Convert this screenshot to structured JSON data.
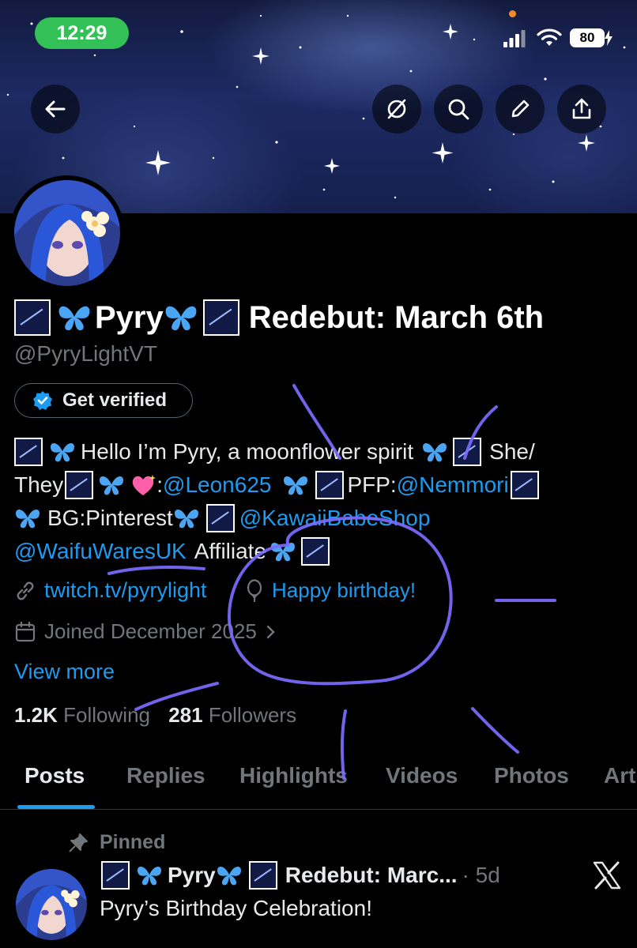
{
  "status_bar": {
    "time": "12:29",
    "battery": "80"
  },
  "profile": {
    "display_name_text": "Pyry",
    "display_name_suffix": "Redebut: March 6th",
    "handle": "@PyryLightVT",
    "verify_label": "Get verified",
    "bio": {
      "line1_text": "Hello I’m Pyry, a moonflower spirit",
      "line1_end": "She/",
      "line2_start": "They",
      "line2_sep": ":",
      "line2_mention1": "@Leon625",
      "line2_pfp": "PFP:",
      "line2_mention2": "@Nemmori",
      "line3_bg": "BG:Pinterest",
      "line3_mention": "@KawaiiBabeShop",
      "line4_mention": "@WaifuWaresUK",
      "line4_text": "Affiliate"
    },
    "website": "twitch.tv/pyrylight",
    "birthday": "Happy birthday!",
    "joined": "Joined December 2025",
    "view_more": "View more",
    "following_count": "1.2K",
    "following_label": "Following",
    "followers_count": "281",
    "followers_label": "Followers"
  },
  "tabs": [
    "Posts",
    "Replies",
    "Highlights",
    "Videos",
    "Photos",
    "Art"
  ],
  "pinned_post": {
    "pinned_label": "Pinned",
    "author_name": "Pyry",
    "author_suffix": "Redebut: Marc...",
    "age": "· 5d",
    "text": "Pyry’s Birthday Celebration!"
  },
  "icons": {
    "back": "back-arrow-icon",
    "grok": "grok-icon",
    "search": "search-icon",
    "edit": "pencil-icon",
    "share": "share-icon"
  },
  "colors": {
    "accent": "#1d9bf0",
    "status_green": "#33c157",
    "doodle": "#7b6cff"
  }
}
